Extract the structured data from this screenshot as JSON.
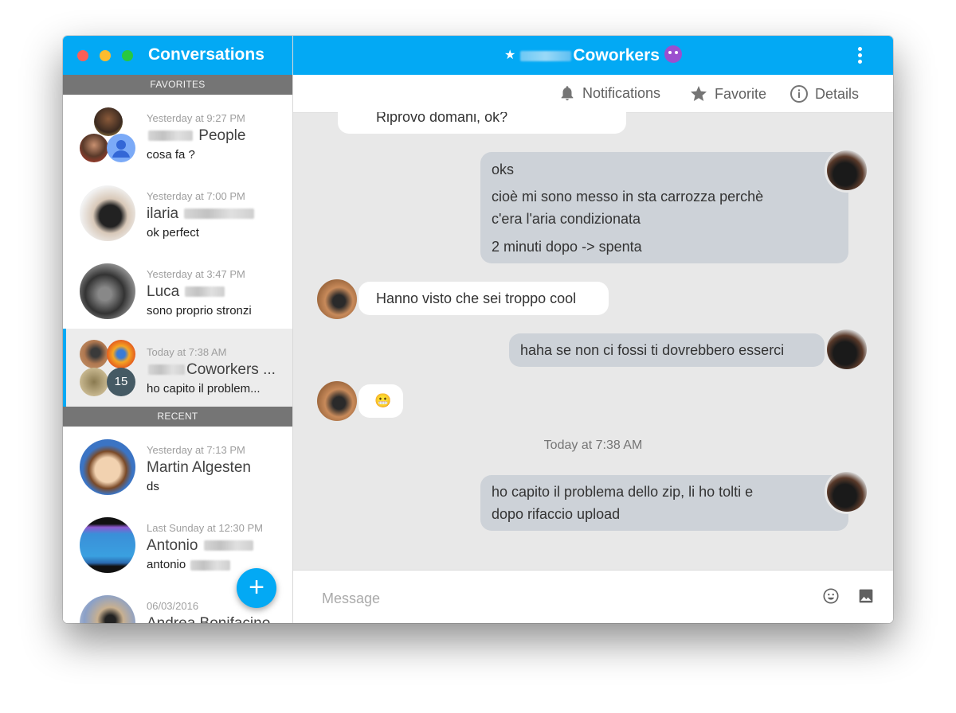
{
  "sidebar": {
    "title": "Conversations",
    "sections": {
      "favorites": "FAVORITES",
      "recent": "RECENT"
    },
    "favorites": [
      {
        "time": "Yesterday at 9:27 PM",
        "name": "People",
        "snippet": "cosa fa ?"
      },
      {
        "time": "Yesterday at 7:00 PM",
        "name": "ilaria",
        "snippet": "ok perfect"
      },
      {
        "time": "Yesterday at 3:47 PM",
        "name": "Luca",
        "snippet": "sono proprio stronzi"
      },
      {
        "time": "Today at 7:38 AM",
        "name": "Coworkers ...",
        "snippet": "ho capito il problem...",
        "badge": "15",
        "active": true
      }
    ],
    "recent": [
      {
        "time": "Yesterday at 7:13 PM",
        "name": "Martin Algesten",
        "snippet": "ds"
      },
      {
        "time": "Last Sunday at 12:30 PM",
        "name": "Antonio",
        "snippet": "antonio"
      },
      {
        "time": "06/03/2016",
        "name": "Andrea Bonifacino",
        "snippet": ""
      }
    ],
    "fab_label": "+"
  },
  "chat": {
    "title_star": "★",
    "title": "Coworkers",
    "toolbar": {
      "notifications": "Notifications",
      "favorite": "Favorite",
      "details": "Details"
    },
    "messages": [
      {
        "direction": "in",
        "text": "Riprovo domani, ok?"
      },
      {
        "direction": "out",
        "lines": [
          "oks",
          "cioè mi sono messo in sta carrozza perchè",
          "c'era l'aria condizionata",
          "2 minuti dopo -> spenta"
        ]
      },
      {
        "direction": "in",
        "text": "Hanno visto che sei troppo cool"
      },
      {
        "direction": "out",
        "text": "haha se non ci fossi ti dovrebbero esserci"
      },
      {
        "direction": "in",
        "text": "😬"
      },
      {
        "direction": "out",
        "lines": [
          "ho capito il problema dello zip, li ho tolti e",
          "dopo rifaccio upload"
        ]
      }
    ],
    "timestamp": "Today at 7:38 AM",
    "composer": {
      "placeholder": "Message",
      "value": ""
    }
  },
  "colors": {
    "accent": "#03a9f4",
    "section_header": "#757575",
    "outgoing_bubble": "#cdd2d8",
    "incoming_bubble": "#ffffff",
    "chat_background": "#e8e8e8"
  }
}
